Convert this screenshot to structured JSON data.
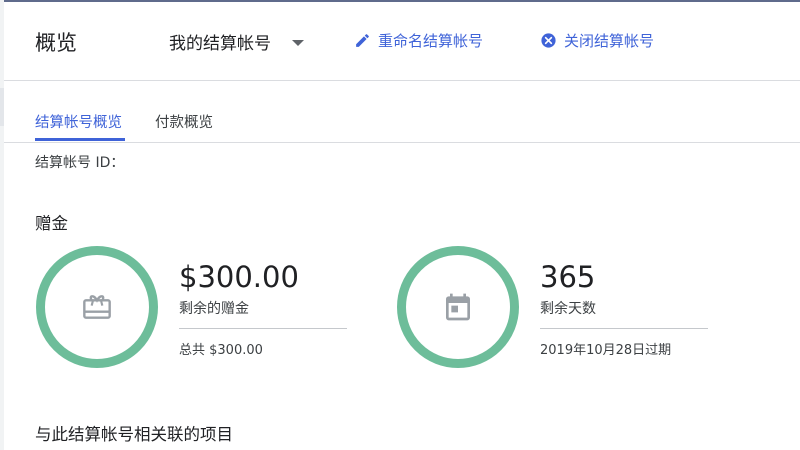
{
  "header": {
    "title": "概览",
    "account_name": "我的结算帐号",
    "rename_label": "重命名结算帐号",
    "close_label": "关闭结算帐号"
  },
  "tabs": [
    {
      "label": "结算帐号概览",
      "active": true
    },
    {
      "label": "付款概览",
      "active": false
    }
  ],
  "account_id_label": "结算帐号 ID：",
  "credits": {
    "title": "赠金",
    "remaining": {
      "value": "$300.00",
      "label": "剩余的赠金",
      "total": "总共 $300.00"
    },
    "days": {
      "value": "365",
      "label": "剩余天数",
      "expires": "2019年10月28日过期"
    }
  },
  "projects_title": "与此结算帐号相关联的项目",
  "colors": {
    "accent": "#3f63d8",
    "ring": "#6dbd9a"
  },
  "icons": [
    "pencil-icon",
    "close-circle-icon",
    "gift-card-icon",
    "calendar-icon",
    "chevron-down-icon"
  ]
}
